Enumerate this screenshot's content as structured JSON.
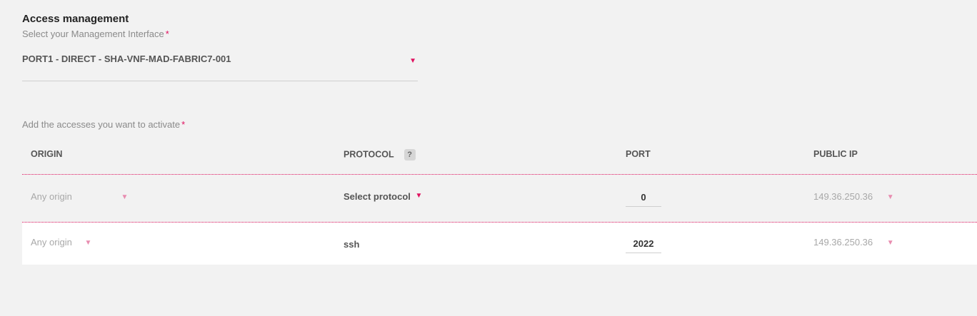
{
  "section": {
    "title": "Access management",
    "interface_label": "Select your Management Interface",
    "required_mark": "*"
  },
  "interface_select": {
    "value": "PORT1 - DIRECT - SHA-VNF-MAD-FABRIC7-001"
  },
  "accesses": {
    "label": "Add the accesses you want to activate",
    "required_mark": "*",
    "columns": {
      "origin": "ORIGIN",
      "protocol": "PROTOCOL",
      "protocol_help": "?",
      "port": "PORT",
      "public_ip": "PUBLIC IP"
    },
    "rows": [
      {
        "origin": "Any origin",
        "protocol": "Select protocol",
        "port": "0",
        "public_ip": "149.36.250.36"
      },
      {
        "origin": "Any origin",
        "protocol": "ssh",
        "port": "2022",
        "public_ip": "149.36.250.36"
      }
    ]
  },
  "icons": {
    "dropdown": "caret-down-icon",
    "help": "question-mark-icon"
  },
  "colors": {
    "accent": "#e0115f",
    "background": "#f2f2f2",
    "muted_text": "#a8a8a8"
  }
}
